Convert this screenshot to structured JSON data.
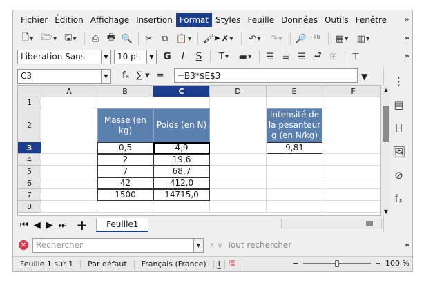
{
  "menubar": {
    "items": [
      "Fichier",
      "Édition",
      "Affichage",
      "Insertion",
      "Format",
      "Styles",
      "Feuille",
      "Données",
      "Outils",
      "Fenêtre"
    ],
    "active": "Format"
  },
  "toolbar2": {
    "font_name": "Liberation Sans",
    "font_size": "10 pt"
  },
  "formula": {
    "cell_ref": "C3",
    "content": "=B3*$E$3"
  },
  "grid": {
    "columns": [
      "A",
      "B",
      "C",
      "D",
      "E",
      "F"
    ],
    "selected_column": "C",
    "rows": [
      "1",
      "2",
      "3",
      "4",
      "5",
      "6",
      "7",
      "8"
    ],
    "selected_row": "3",
    "headers": {
      "mass": "Masse (en kg)",
      "weight": "Poids (en N)",
      "gravity": "Intensité de la pesanteur g (en N/kg)"
    },
    "mass_values": [
      "0,5",
      "2",
      "7",
      "42",
      "1500"
    ],
    "weight_values": [
      "4,9",
      "19,6",
      "68,7",
      "412,0",
      "14715,0"
    ],
    "gravity_value": "9,81"
  },
  "sheets": {
    "tabs": [
      "Feuille1"
    ],
    "active": "Feuille1"
  },
  "find": {
    "placeholder": "Rechercher",
    "find_all": "Tout rechercher"
  },
  "status": {
    "sheet": "Feuille 1 sur 1",
    "style": "Par défaut",
    "language": "Français (France)",
    "zoom": "100 %"
  },
  "colors": {
    "accent": "#1c3c8c",
    "header_fill": "#5b80b0"
  }
}
